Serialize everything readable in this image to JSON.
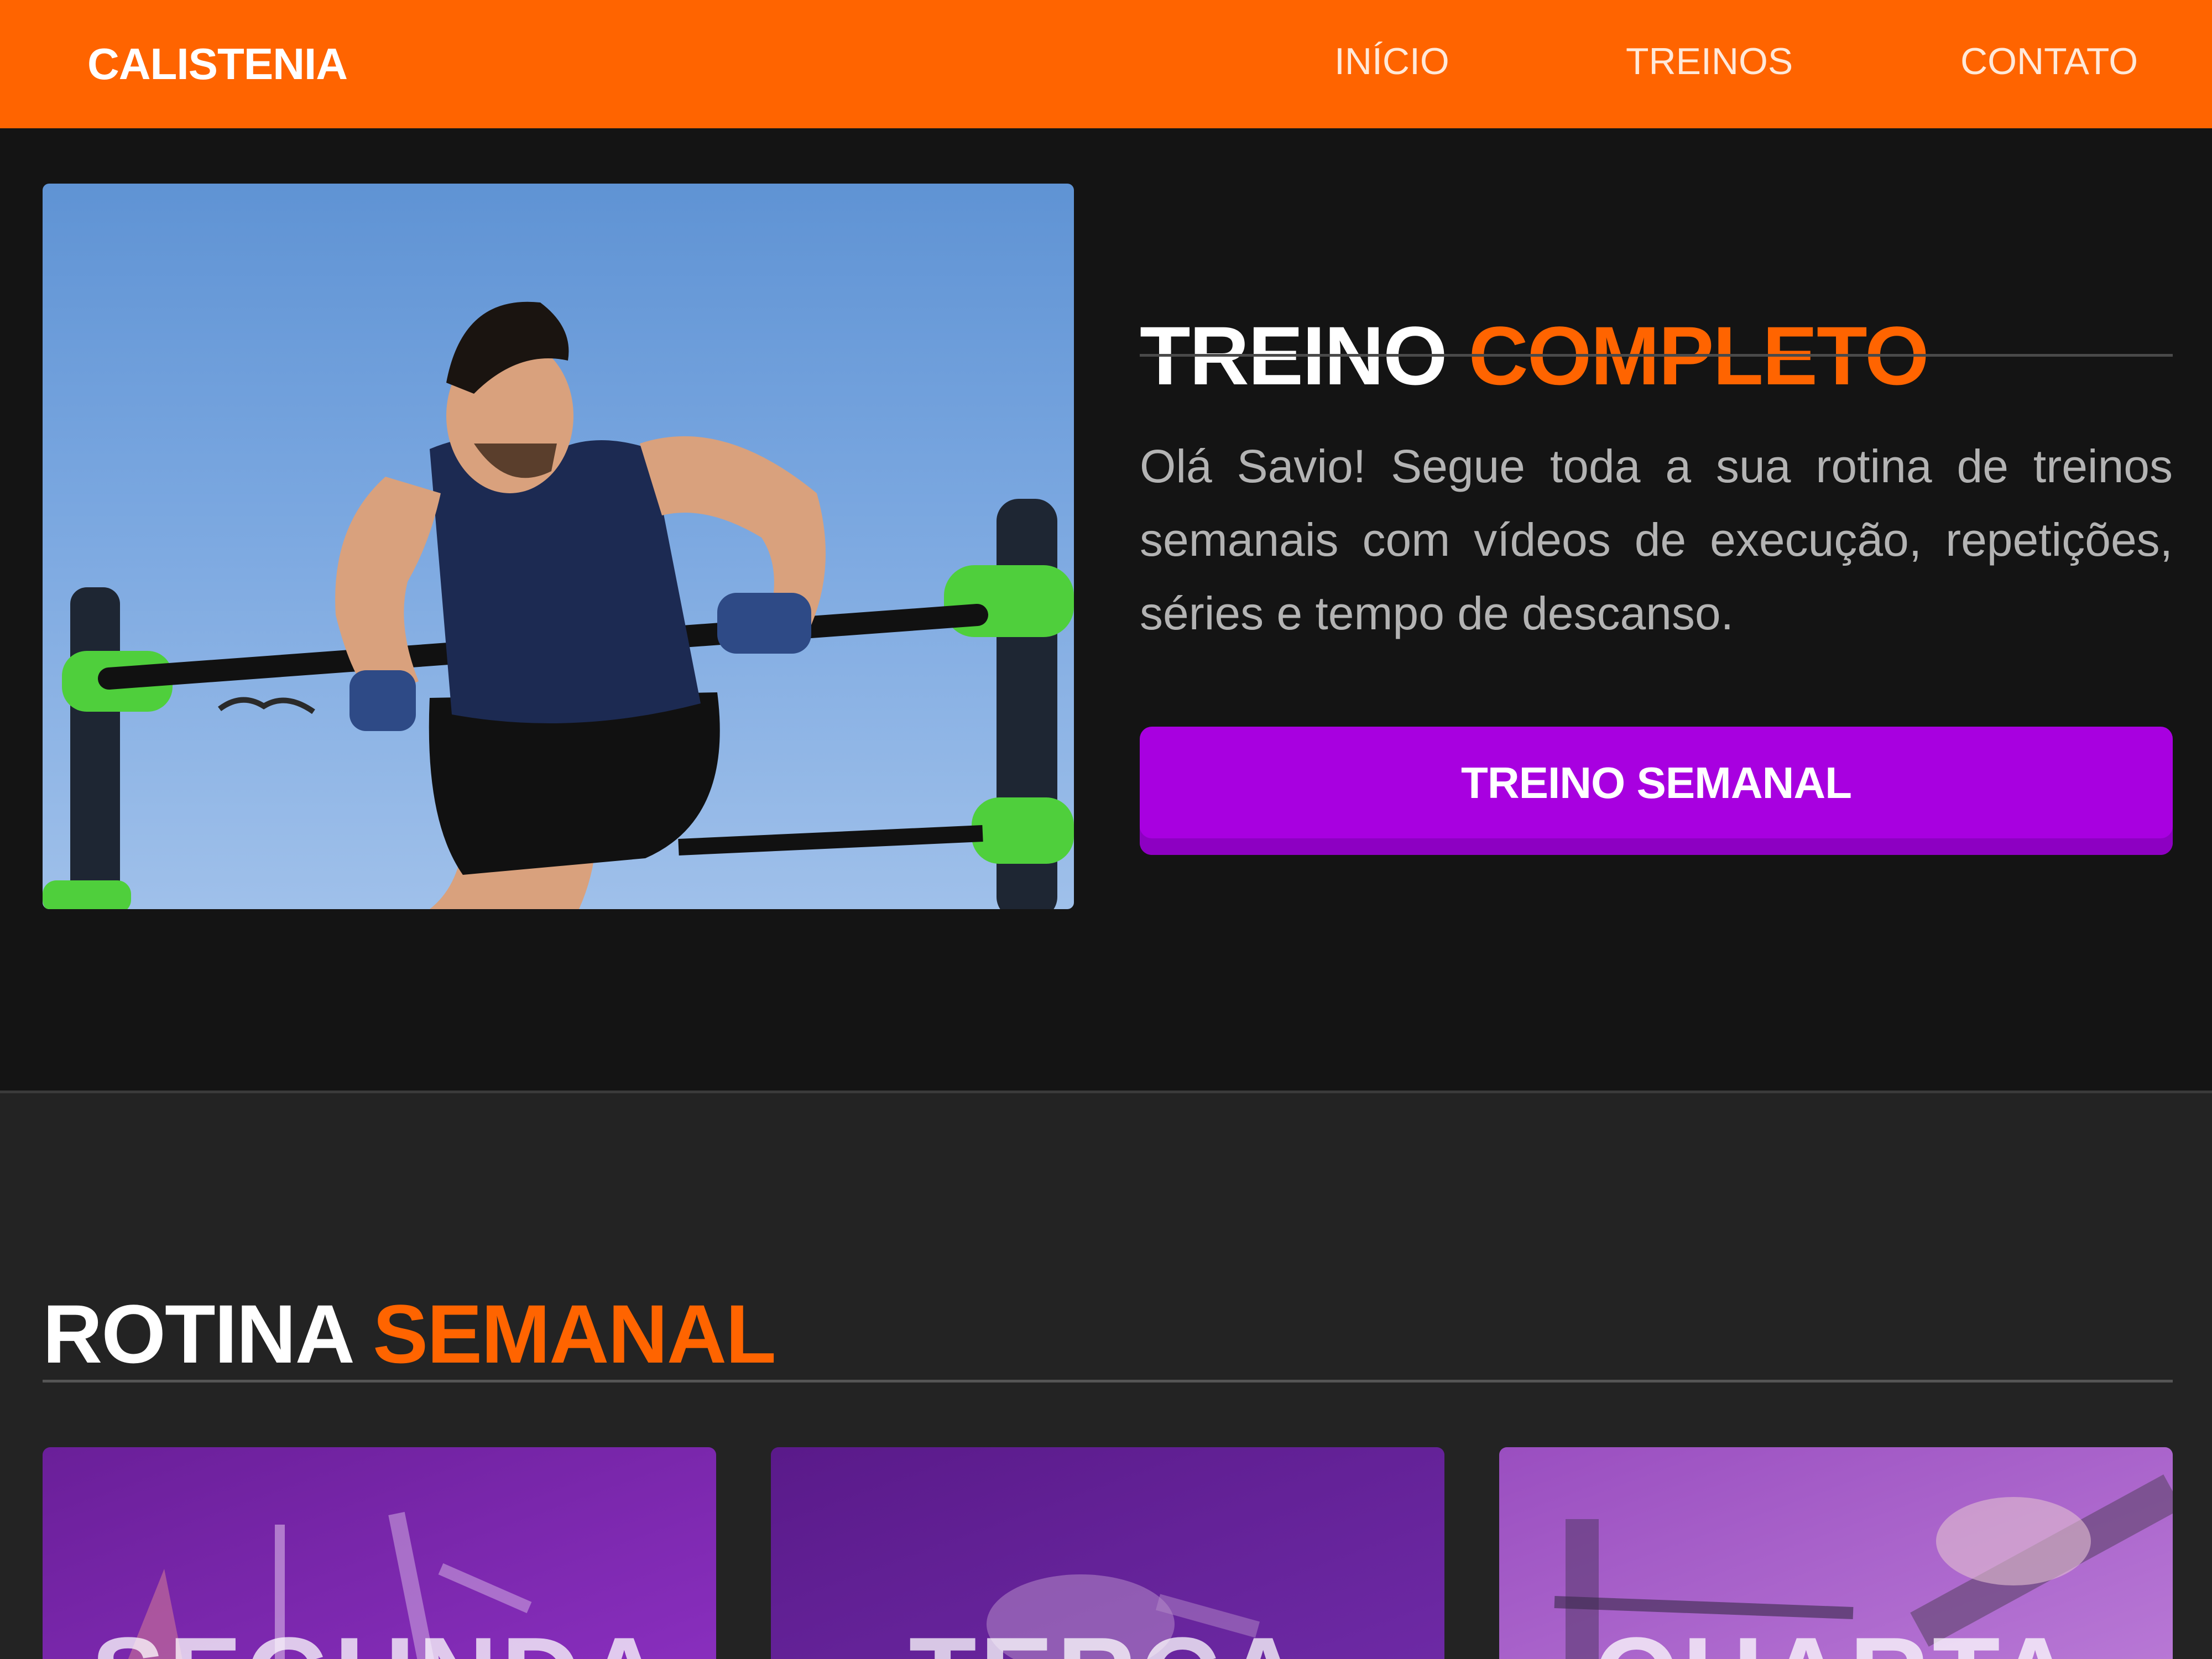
{
  "nav": {
    "brand": "CALISTENIA",
    "links": [
      "INÍCIO",
      "TREINOS",
      "CONTATO"
    ]
  },
  "hero": {
    "title_white": "TREINO",
    "title_accent": "COMPLETO",
    "description": "Olá Savio! Segue toda a sua rotina de treinos semanais com vídeos de execução, repetições, séries e tempo de descanso.",
    "button_label": "TREINO SEMANAL"
  },
  "routine": {
    "title_white": "ROTINA",
    "title_accent": "SEMANAL",
    "days": [
      "SEGUNDA",
      "TERÇA",
      "QUARTA"
    ]
  },
  "colors": {
    "brand_orange": "#ff6400",
    "button_purple": "#a800e0",
    "background_dark": "#141414",
    "section_dark": "#232323"
  }
}
